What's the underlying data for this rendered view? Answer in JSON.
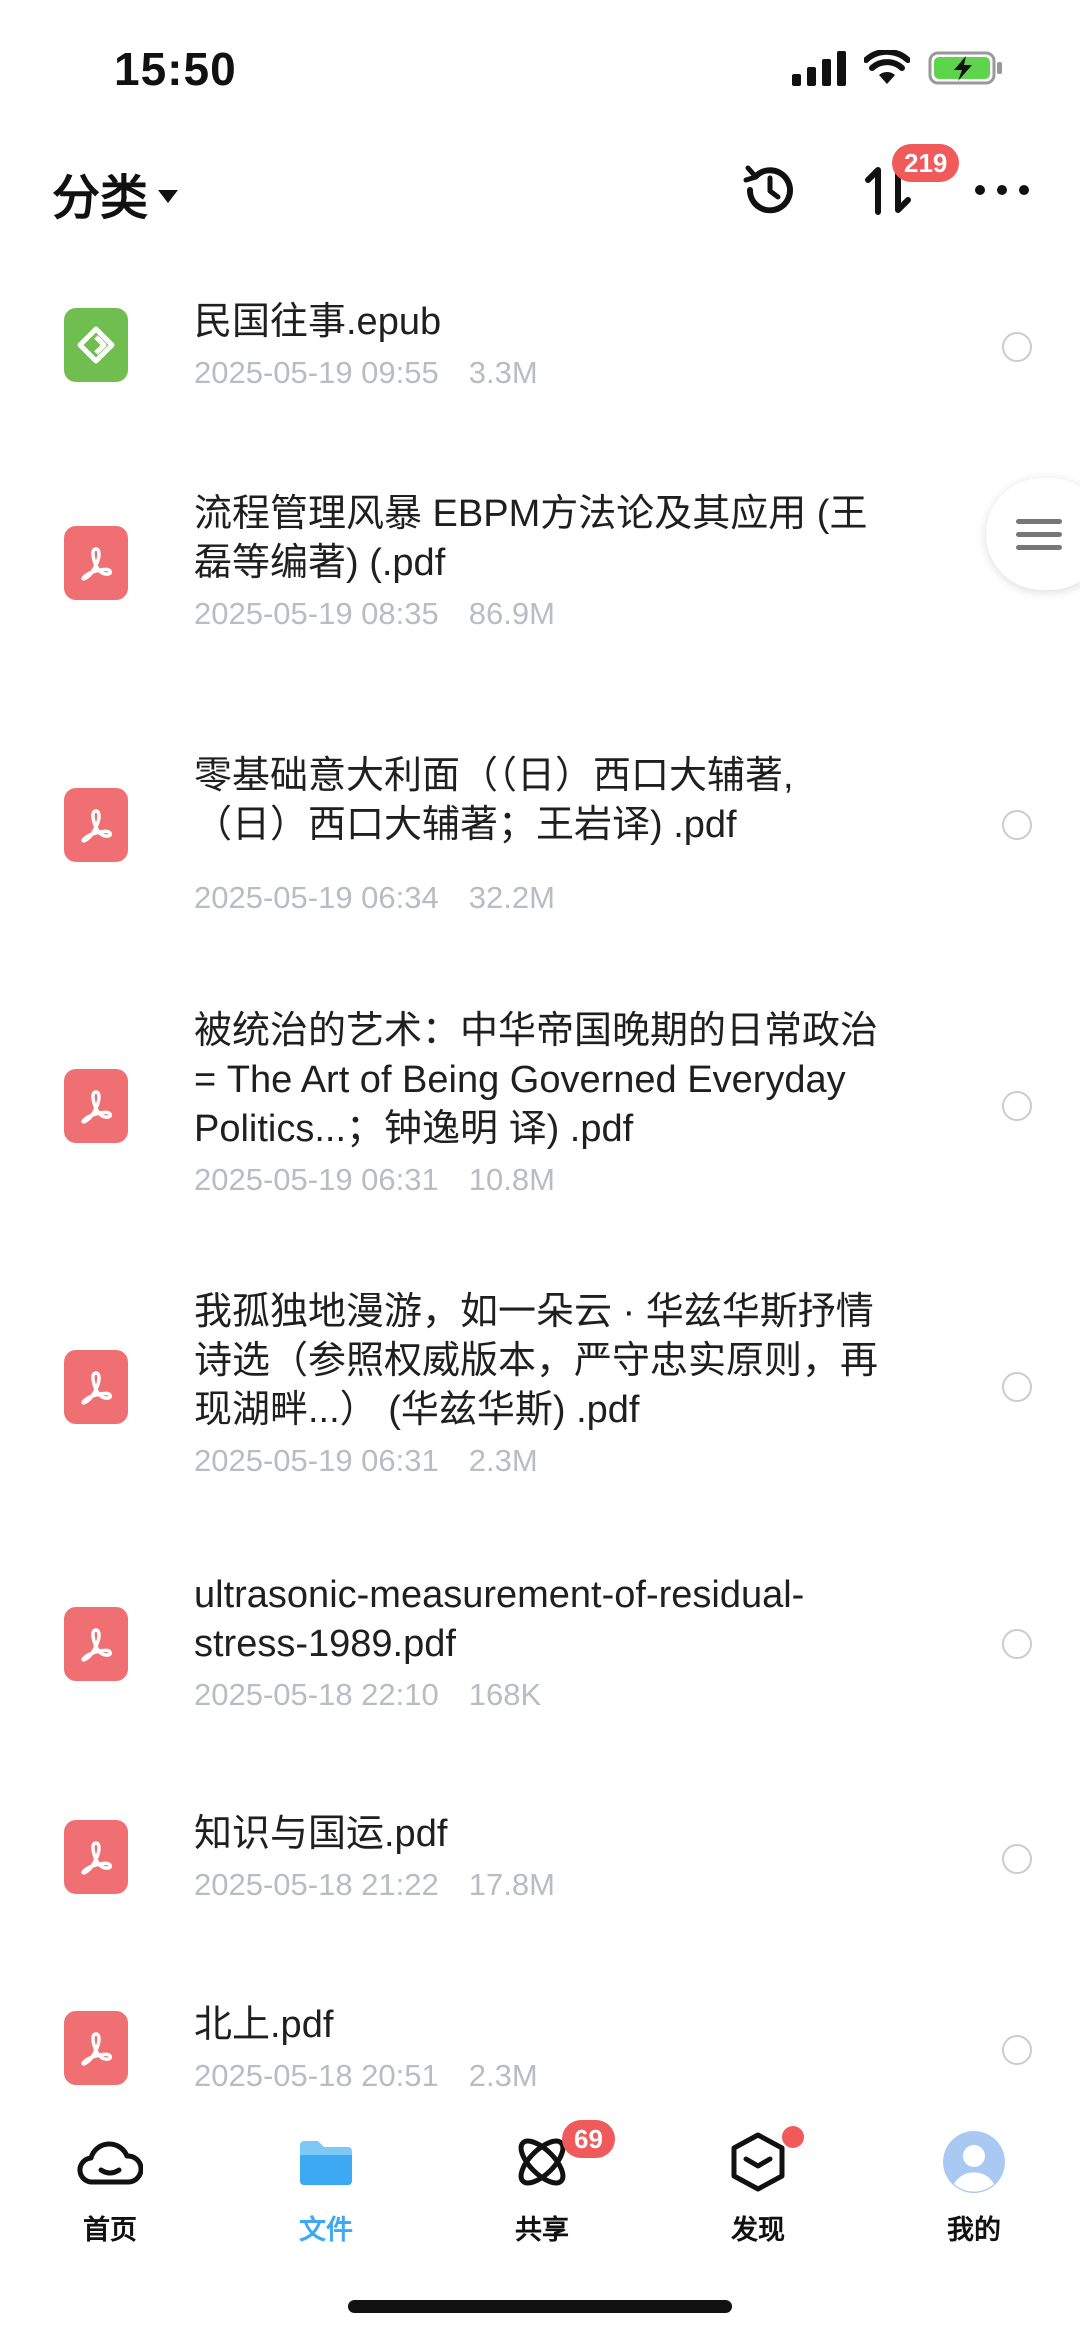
{
  "status_bar": {
    "time": "15:50"
  },
  "header": {
    "category_label": "分类",
    "sort_badge": "219"
  },
  "files": [
    {
      "name": "民国往事.epub",
      "date": "2025-05-19 09:55",
      "size": "3.3M",
      "type": "epub"
    },
    {
      "name": "流程管理风暴 EBPM方法论及其应用 (王磊等编著) (.pdf",
      "date": "2025-05-19 08:35",
      "size": "86.9M",
      "type": "pdf"
    },
    {
      "name": "零基础意大利面（（日）西口大辅著,（日）西口大辅著；王岩译) .pdf",
      "date": "2025-05-19 06:34",
      "size": "32.2M",
      "type": "pdf"
    },
    {
      "name": "被统治的艺术：中华帝国晚期的日常政治 = The Art of Being Governed Everyday Politics...；钟逸明 译) .pdf",
      "date": "2025-05-19 06:31",
      "size": "10.8M",
      "type": "pdf"
    },
    {
      "name": "我孤独地漫游，如一朵云 · 华兹华斯抒情诗选（参照权威版本，严守忠实原则，再现湖畔...） (华兹华斯) .pdf",
      "date": "2025-05-19 06:31",
      "size": "2.3M",
      "type": "pdf"
    },
    {
      "name": "ultrasonic-measurement-of-residual-stress-1989.pdf",
      "date": "2025-05-18 22:10",
      "size": "168K",
      "type": "pdf"
    },
    {
      "name": "知识与国运.pdf",
      "date": "2025-05-18 21:22",
      "size": "17.8M",
      "type": "pdf"
    },
    {
      "name": "北上.pdf",
      "date": "2025-05-18 20:51",
      "size": "2.3M",
      "type": "pdf"
    }
  ],
  "bottom_nav": {
    "home": "首页",
    "files": "文件",
    "share": "共享",
    "share_badge": "69",
    "discover": "发现",
    "mine": "我的"
  },
  "colors": {
    "accent": "#3da9f2",
    "pdf_icon": "#ef6f72",
    "epub_icon": "#6fbe4f",
    "badge": "#f05a5a",
    "meta_text": "#b9bcc4"
  }
}
